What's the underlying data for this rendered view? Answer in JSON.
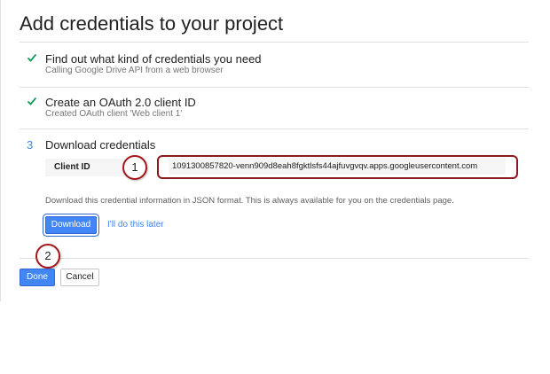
{
  "page": {
    "title": "Add credentials to your project"
  },
  "steps": [
    {
      "status": "complete",
      "icon": "checkmark-icon",
      "title": "Find out what kind of credentials you need",
      "subtitle": "Calling Google Drive API from a web browser"
    },
    {
      "status": "complete",
      "icon": "checkmark-icon",
      "title": "Create an OAuth 2.0 client ID",
      "subtitle": "Created OAuth client 'Web client 1'"
    },
    {
      "status": "active",
      "number": "3",
      "title": "Download credentials"
    }
  ],
  "download": {
    "client_id_label": "Client ID",
    "client_id_value": "1091300857820-venn909d8eah8fgktlsfs44ajfuvgvqv.apps.googleusercontent.com",
    "info": "Download this credential information in JSON format. This is always available for you on the credentials page.",
    "download_label": "Download",
    "later_label": "I'll do this later"
  },
  "annotations": {
    "callout_1": "1",
    "callout_2": "2"
  },
  "footer": {
    "done_label": "Done",
    "cancel_label": "Cancel"
  },
  "colors": {
    "check": "#0f9d58",
    "primary": "#4285f4",
    "callout_border": "#a4161a"
  }
}
